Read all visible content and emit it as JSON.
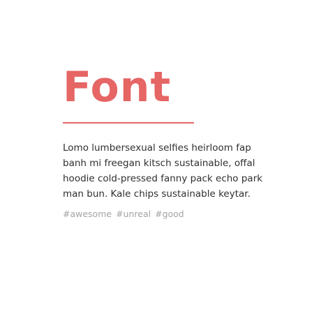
{
  "card": {
    "title": "Font",
    "body": "Lomo lumbersexual selfies heirloom fap banh mi freegan kitsch sustainable, offal hoodie cold-pressed fanny pack echo park man bun. Kale chips sustainable keytar.",
    "tags": [
      "#awesome",
      "#unreal",
      "#good"
    ]
  },
  "colors": {
    "accent": "#e66565",
    "text": "#2f2f2f",
    "muted": "#a3a3a3"
  }
}
